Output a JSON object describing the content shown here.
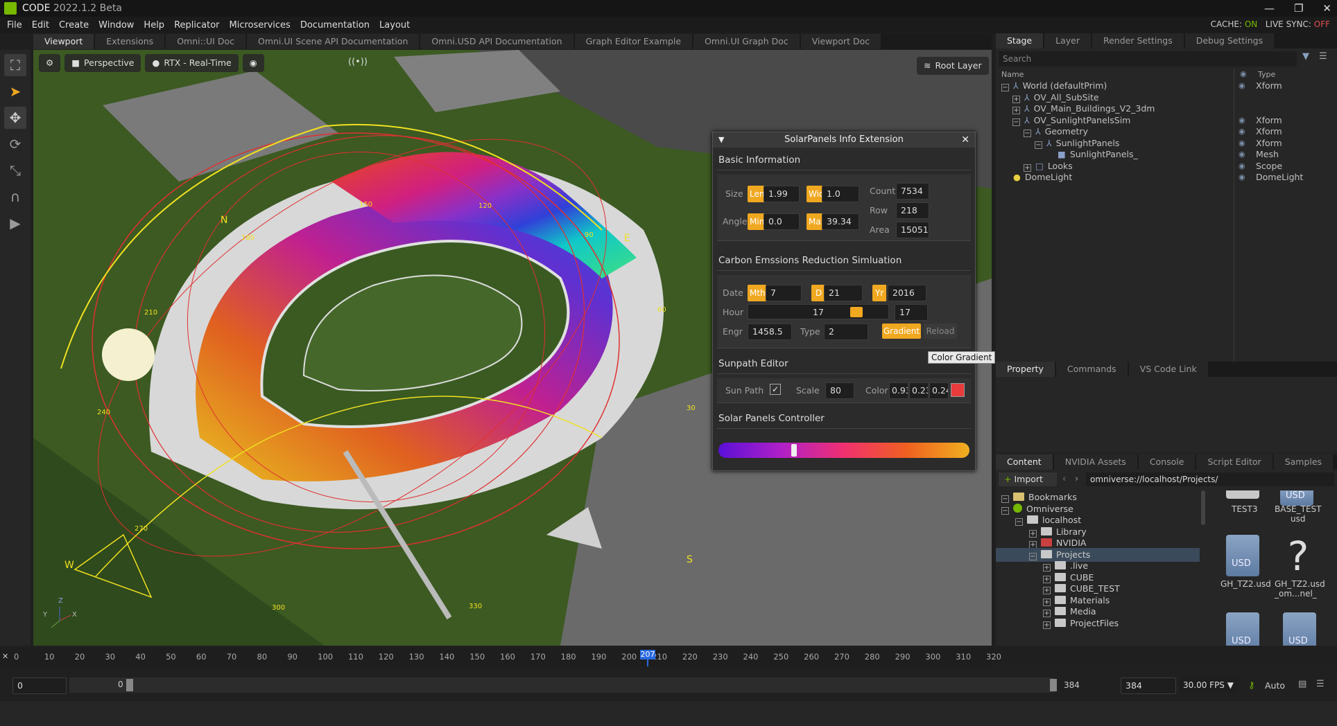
{
  "app": {
    "name": "CODE",
    "version": "2022.1.2 Beta"
  },
  "window_controls": {
    "minimize": "—",
    "maximize": "❐",
    "close": "✕"
  },
  "menu": [
    "File",
    "Edit",
    "Create",
    "Window",
    "Help",
    "Replicator",
    "Microservices",
    "Documentation",
    "Layout"
  ],
  "status_right": {
    "cache_label": "CACHE:",
    "cache_value": "ON",
    "sync_label": "LIVE SYNC:",
    "sync_value": "OFF"
  },
  "doc_tabs": [
    "Viewport",
    "Extensions",
    "Omni::UI Doc",
    "Omni.UI Scene API Documentation",
    "Omni.USD API Documentation",
    "Graph Editor Example",
    "Omni.UI Graph Doc",
    "Viewport Doc"
  ],
  "viewport": {
    "camera": "Perspective",
    "renderer": "RTX - Real-Time",
    "root_layer": "Root Layer",
    "sun_labels": {
      "n": "N",
      "e": "E",
      "w": "W",
      "s": "S"
    },
    "azimuths": [
      "30",
      "90",
      "120",
      "150",
      "180",
      "210",
      "240",
      "270",
      "300",
      "330",
      "60"
    ],
    "axes": {
      "x": "X",
      "y": "Y",
      "z": "Z"
    }
  },
  "dialog": {
    "title": "SolarPanels Info Extension",
    "basic": {
      "header": "Basic Information",
      "size_label": "Size",
      "len_badge": "Len",
      "len": "1.99",
      "wid_badge": "Wid",
      "wid": "1.0",
      "angle_label": "Angle",
      "min_badge": "Min",
      "min": "0.0",
      "max_badge": "Max",
      "max": "39.34",
      "count_label": "Count",
      "count": "7534",
      "row_label": "Row",
      "row": "218",
      "area_label": "Area",
      "area": "15051"
    },
    "carbon": {
      "header": "Carbon Emssions Reduction Simluation",
      "date_label": "Date",
      "mth_badge": "Mth",
      "mth": "7",
      "d_badge": "D",
      "d": "21",
      "yr_badge": "Yr",
      "yr": "2016",
      "hour_label": "Hour",
      "hour_slider": "17",
      "hour": "17",
      "hour_fraction": 0.72,
      "engr_label": "Engr",
      "engr": "1458.5",
      "type_label": "Type",
      "type": "2",
      "gradient_btn": "Gradient",
      "reload_btn": "Reload"
    },
    "sunpath": {
      "header": "Sunpath Editor",
      "sun_path_label": "Sun Path",
      "sun_path_checked": true,
      "scale_label": "Scale",
      "scale": "80",
      "color_label": "Color",
      "r": "0.93",
      "g": "0.23",
      "b": "0.24",
      "swatch": "#e83c3c"
    },
    "controller": {
      "header": "Solar Panels Controller",
      "handle_fraction": 0.29
    }
  },
  "tooltip": "Color Gradient",
  "stage": {
    "tabs": [
      "Stage",
      "Layer",
      "Render Settings",
      "Debug Settings"
    ],
    "search_placeholder": "Search",
    "col_name": "Name",
    "col_type": "Type",
    "items": [
      {
        "name": "World (defaultPrim)",
        "type": "Xform"
      },
      {
        "name": "OV_All_SubSite",
        "type": ""
      },
      {
        "name": "OV_Main_Buildings_V2_3dm",
        "type": ""
      },
      {
        "name": "OV_SunlightPanelsSim",
        "type": "Xform"
      },
      {
        "name": "Geometry",
        "type": "Xform"
      },
      {
        "name": "SunlightPanels",
        "type": "Xform"
      },
      {
        "name": "SunlightPanels_",
        "type": "Mesh"
      },
      {
        "name": "Looks",
        "type": "Scope"
      },
      {
        "name": "DomeLight",
        "type": "DomeLight"
      }
    ]
  },
  "property": {
    "tabs": [
      "Property",
      "Commands",
      "VS Code Link"
    ]
  },
  "content": {
    "tabs": [
      "Content",
      "NVIDIA Assets",
      "Console",
      "Script Editor",
      "Samples"
    ],
    "import": "Import",
    "path": "omniverse://localhost/Projects/",
    "tree": [
      "Bookmarks",
      "Omniverse",
      "localhost",
      "Library",
      "NVIDIA",
      "Projects",
      ".live",
      "CUBE",
      "CUBE_TEST",
      "Materials",
      "Media",
      "ProjectFiles"
    ],
    "files": [
      {
        "name": "TEST3"
      },
      {
        "name": "BASE_TEST\nusd"
      },
      {
        "name": "GH_TZ2.usd"
      },
      {
        "name": "GH_TZ2.usd\n_om...nel_"
      }
    ],
    "usd_label": "USD",
    "unknown_glyph": "?"
  },
  "timeline": {
    "ticks": [
      "0",
      "10",
      "20",
      "30",
      "40",
      "50",
      "60",
      "70",
      "80",
      "90",
      "100",
      "110",
      "120",
      "130",
      "140",
      "150",
      "160",
      "170",
      "180",
      "190",
      "200",
      "210",
      "220",
      "230",
      "240",
      "250",
      "260",
      "270",
      "280",
      "290",
      "300",
      "310",
      "320"
    ],
    "current": "207",
    "current_fraction": 0.6469,
    "start": "0",
    "start2": "0",
    "end": "384",
    "end2": "384",
    "fps": "30.00 FPS",
    "auto": "Auto"
  }
}
